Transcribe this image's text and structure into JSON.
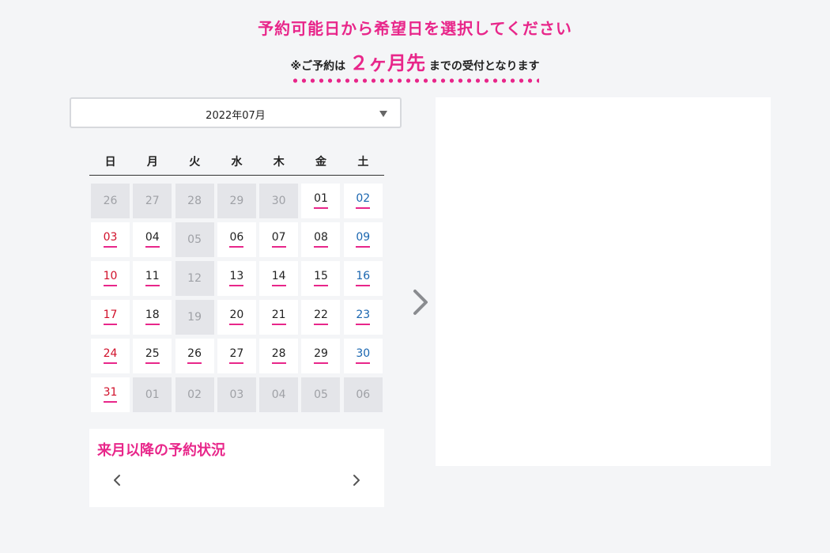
{
  "header": {
    "title": "予約可能日から希望日を選択してください",
    "notice_prefix": "※ご予約は",
    "notice_highlight": "２ヶ月先",
    "notice_suffix": "までの受付となります"
  },
  "calendar": {
    "month_select": "2022年07月",
    "weekdays": [
      "日",
      "月",
      "火",
      "水",
      "木",
      "金",
      "土"
    ],
    "days": [
      {
        "d": "26",
        "s": "inactive"
      },
      {
        "d": "27",
        "s": "inactive"
      },
      {
        "d": "28",
        "s": "inactive"
      },
      {
        "d": "29",
        "s": "inactive"
      },
      {
        "d": "30",
        "s": "inactive"
      },
      {
        "d": "01",
        "s": "avail"
      },
      {
        "d": "02",
        "s": "avail"
      },
      {
        "d": "03",
        "s": "avail"
      },
      {
        "d": "04",
        "s": "avail"
      },
      {
        "d": "05",
        "s": "inactive"
      },
      {
        "d": "06",
        "s": "avail"
      },
      {
        "d": "07",
        "s": "avail"
      },
      {
        "d": "08",
        "s": "avail"
      },
      {
        "d": "09",
        "s": "avail"
      },
      {
        "d": "10",
        "s": "avail"
      },
      {
        "d": "11",
        "s": "avail"
      },
      {
        "d": "12",
        "s": "inactive"
      },
      {
        "d": "13",
        "s": "avail"
      },
      {
        "d": "14",
        "s": "avail"
      },
      {
        "d": "15",
        "s": "avail"
      },
      {
        "d": "16",
        "s": "avail"
      },
      {
        "d": "17",
        "s": "avail"
      },
      {
        "d": "18",
        "s": "avail"
      },
      {
        "d": "19",
        "s": "inactive"
      },
      {
        "d": "20",
        "s": "avail"
      },
      {
        "d": "21",
        "s": "avail"
      },
      {
        "d": "22",
        "s": "avail"
      },
      {
        "d": "23",
        "s": "avail"
      },
      {
        "d": "24",
        "s": "avail"
      },
      {
        "d": "25",
        "s": "avail"
      },
      {
        "d": "26",
        "s": "avail"
      },
      {
        "d": "27",
        "s": "avail"
      },
      {
        "d": "28",
        "s": "avail"
      },
      {
        "d": "29",
        "s": "avail"
      },
      {
        "d": "30",
        "s": "avail"
      },
      {
        "d": "31",
        "s": "avail"
      },
      {
        "d": "01",
        "s": "inactive"
      },
      {
        "d": "02",
        "s": "inactive"
      },
      {
        "d": "03",
        "s": "inactive"
      },
      {
        "d": "04",
        "s": "inactive"
      },
      {
        "d": "05",
        "s": "inactive"
      },
      {
        "d": "06",
        "s": "inactive"
      }
    ]
  },
  "future": {
    "title": "来月以降の予約状況"
  },
  "icons": {
    "next_month": "chevron-right-icon",
    "dropdown": "caret-down-icon",
    "future_prev": "chevron-left-icon",
    "future_next": "chevron-right-icon"
  },
  "colors": {
    "accent": "#e8268a",
    "sunday": "#d1102a",
    "saturday": "#1a66b0",
    "inactive_bg": "#e4e5e9",
    "page_bg": "#f4f5f7"
  }
}
